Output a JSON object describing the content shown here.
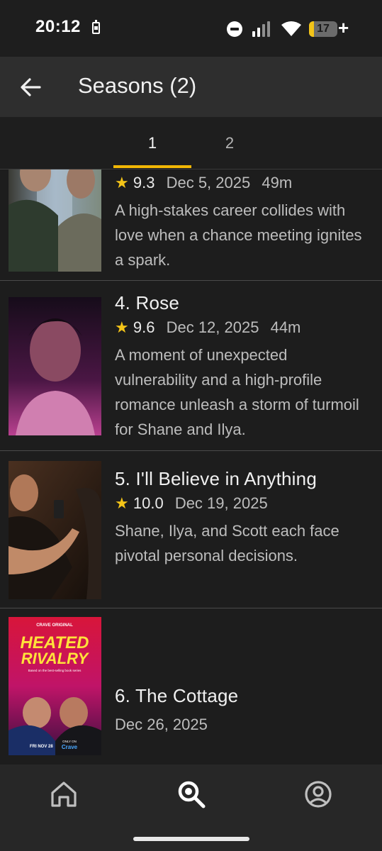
{
  "status_bar": {
    "time": "20:12",
    "battery_level": "17",
    "icons": [
      "battery-saver-icon",
      "dnd-icon",
      "signal-icon",
      "wifi-icon",
      "battery-icon",
      "charging-plus-icon"
    ]
  },
  "app_bar": {
    "title": "Seasons (2)",
    "back_icon": "arrow-left-icon"
  },
  "tabs": [
    {
      "label": "1",
      "active": true
    },
    {
      "label": "2",
      "active": false
    }
  ],
  "episodes": [
    {
      "title": "",
      "rating": "9.3",
      "date": "Dec 5, 2025",
      "runtime": "49m",
      "description": "A high-stakes career collides with love when a chance meeting ignites a spark."
    },
    {
      "title": "4. Rose",
      "rating": "9.6",
      "date": "Dec 12, 2025",
      "runtime": "44m",
      "description": "A moment of unexpected vulnerability and a high-profile romance unleash a storm of turmoil for Shane and Ilya."
    },
    {
      "title": "5. I'll Believe in Anything",
      "rating": "10.0",
      "date": "Dec 19, 2025",
      "runtime": "",
      "description": "Shane, Ilya, and Scott each face pivotal personal decisions."
    },
    {
      "title": "6. The Cottage",
      "rating": "",
      "date": "Dec 26, 2025",
      "runtime": "",
      "description": ""
    }
  ],
  "poster": {
    "brand": "CRAVE ORIGINAL",
    "line1": "HEATED",
    "line2": "RIVALRY",
    "tagline": "Based on the best-selling book series",
    "date": "FRI NOV 28",
    "only_on": "ONLY ON",
    "service": "Crave"
  },
  "bottom_nav": [
    {
      "name": "home",
      "icon": "home-icon",
      "active": false
    },
    {
      "name": "search",
      "icon": "search-icon",
      "active": true
    },
    {
      "name": "profile",
      "icon": "profile-icon",
      "active": false
    }
  ],
  "colors": {
    "accent": "#f2b705",
    "star": "#f5c518",
    "background": "#1d1d1d",
    "app_bar": "#2e2e2e"
  }
}
